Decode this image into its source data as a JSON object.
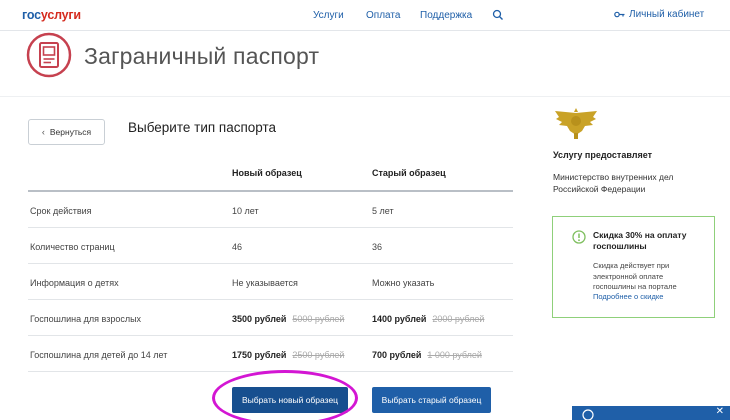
{
  "header": {
    "logo_part1": "гос",
    "logo_part2": "услуги",
    "nav": [
      "Услуги",
      "Оплата",
      "Поддержка"
    ],
    "cabinet": "Личный кабинет"
  },
  "page": {
    "title": "Заграничный паспорт",
    "back_label": "Вернуться",
    "heading": "Выберите тип паспорта"
  },
  "table": {
    "columns": [
      "Новый образец",
      "Старый образец"
    ],
    "rows": [
      {
        "label": "Срок действия",
        "new": "10 лет",
        "old": "5 лет"
      },
      {
        "label": "Количество страниц",
        "new": "46",
        "old": "36"
      },
      {
        "label": "Информация о детях",
        "new": "Не указывается",
        "old": "Можно указать"
      },
      {
        "label": "Госпошлина для взрослых",
        "new": "3500 рублей",
        "new_old_price": "5000 рублей",
        "old": "1400 рублей",
        "old_old_price": "2000 рублей"
      },
      {
        "label": "Госпошлина для детей до 14 лет",
        "new": "1750 рублей",
        "new_old_price": "2500 рублей",
        "old": "700 рублей",
        "old_old_price": "1 000 рублей"
      }
    ]
  },
  "buttons": {
    "choose_new": "Выбрать новый образец",
    "choose_old": "Выбрать старый образец"
  },
  "sidebar": {
    "provider_label": "Услугу предоставляет",
    "provider_name": "Министерство внутренних дел Российской Федерации",
    "promo_title": "Скидка 30% на оплату госпошлины",
    "promo_text": "Скидка действует при электронной оплате госпошлины на портале",
    "promo_link": "Подробнее о скидке"
  },
  "colors": {
    "brand_blue": "#1f5fa8",
    "brand_red": "#d52b1e",
    "highlight": "#d316d3",
    "promo_border": "#8fd07a"
  }
}
